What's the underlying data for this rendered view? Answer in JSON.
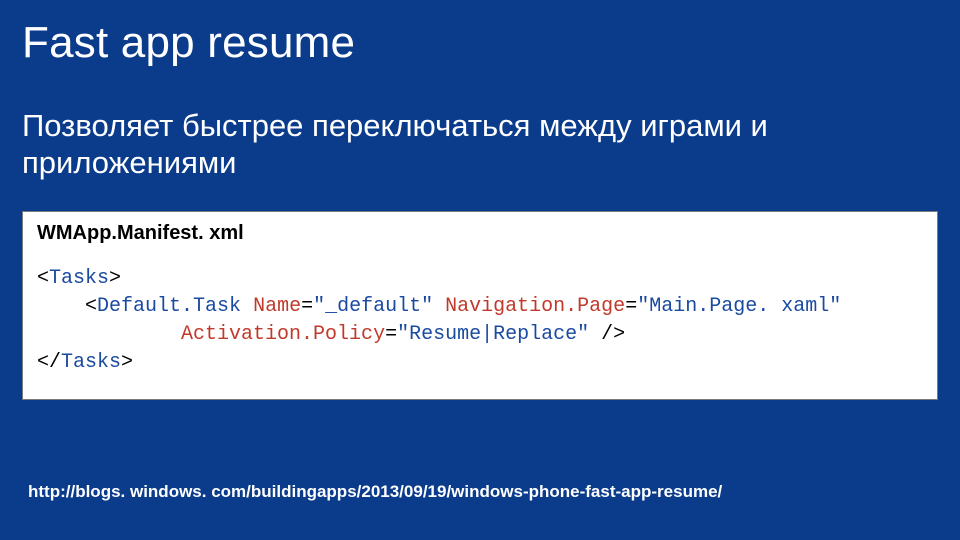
{
  "slide": {
    "title": "Fast app resume",
    "subtitle": "Позволяет быстрее переключаться между играми и приложениями",
    "code_filename": "WMApp.Manifest. xml",
    "code": {
      "line1_open_lt": "<",
      "line1_tag": "Tasks",
      "line1_open_gt": ">",
      "line2_indent": "    ",
      "line2_open_lt": "<",
      "line2_tag": "Default.Task",
      "line2_sp": " ",
      "line2_attr1": "Name",
      "line2_eq1": "=",
      "line2_val1": "\"_default\"",
      "line2_sp2": " ",
      "line2_attr2": "Navigation.Page",
      "line2_eq2": "=",
      "line2_val2": "\"Main.Page. xaml\"",
      "line3_indent": "            ",
      "line3_attr": "Activation.Policy",
      "line3_eq": "=",
      "line3_val": "\"Resume|Replace\"",
      "line3_close": " />",
      "line4_open_lt": "</",
      "line4_tag": "Tasks",
      "line4_open_gt": ">"
    },
    "footer_url": "http://blogs. windows. com/buildingapps/2013/09/19/windows-phone-fast-app-resume/"
  }
}
